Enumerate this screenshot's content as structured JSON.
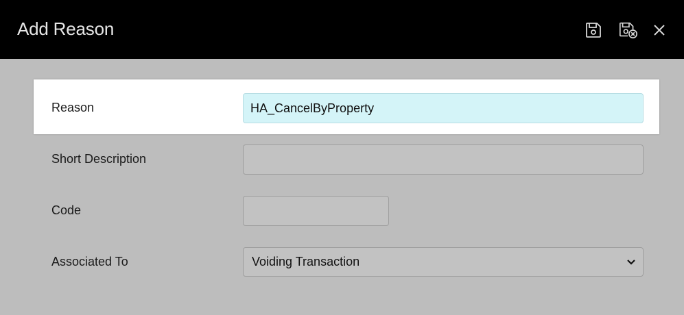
{
  "header": {
    "title": "Add Reason",
    "icons": [
      "save-icon",
      "save-close-icon",
      "close-icon"
    ]
  },
  "form": {
    "reason": {
      "label": "Reason",
      "value": "HA_CancelByProperty"
    },
    "short_description": {
      "label": "Short Description",
      "value": ""
    },
    "code": {
      "label": "Code",
      "value": ""
    },
    "associated_to": {
      "label": "Associated To",
      "selected": "Voiding Transaction"
    }
  },
  "colors": {
    "header_bg": "#000000",
    "page_bg": "#bdbdbd",
    "active_field_bg": "#d4f4f8"
  }
}
